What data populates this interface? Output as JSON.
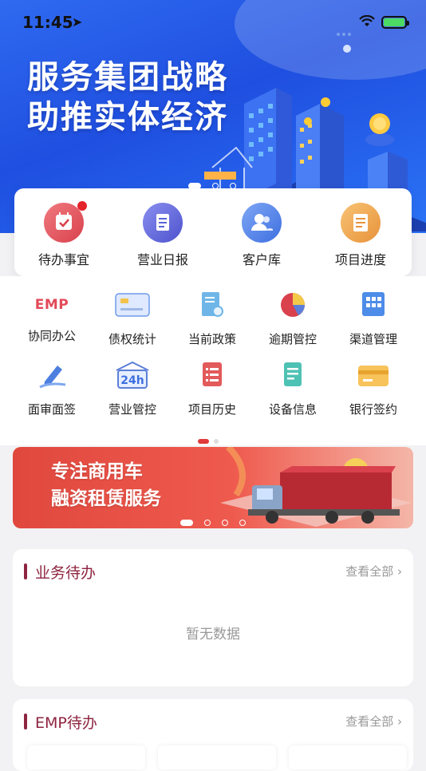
{
  "status_bar": {
    "time": "11:45",
    "location_icon": "location-arrow-icon"
  },
  "banner": {
    "line1": "服务集团战略",
    "line2": "助推实体经济"
  },
  "quick_actions": [
    {
      "label": "待办事宜",
      "icon": "calendar-check-icon",
      "color": "#e2545d",
      "badge": true
    },
    {
      "label": "营业日报",
      "icon": "document-icon",
      "color": "#5b63d8",
      "badge": false
    },
    {
      "label": "客户库",
      "icon": "users-icon",
      "color": "#4b7ee8",
      "badge": false
    },
    {
      "label": "项目进度",
      "icon": "list-icon",
      "color": "#efa24a",
      "badge": false
    }
  ],
  "grid_items": [
    {
      "label": "协同办公",
      "icon": "emp-logo-icon"
    },
    {
      "label": "债权统计",
      "icon": "card-icon"
    },
    {
      "label": "当前政策",
      "icon": "certificate-icon"
    },
    {
      "label": "逾期管控",
      "icon": "pie-chart-icon"
    },
    {
      "label": "渠道管理",
      "icon": "building-icon"
    },
    {
      "label": "面审面签",
      "icon": "pen-sign-icon"
    },
    {
      "label": "营业管控",
      "icon": "24h-icon"
    },
    {
      "label": "项目历史",
      "icon": "history-list-icon"
    },
    {
      "label": "设备信息",
      "icon": "device-doc-icon"
    },
    {
      "label": "银行签约",
      "icon": "bank-card-icon"
    }
  ],
  "emp_logo_text": "EMP",
  "h24_text": "24h",
  "promo": {
    "line1": "专注商用车",
    "line2": "融资租赁服务"
  },
  "business_todo": {
    "title": "业务待办",
    "view_all": "查看全部",
    "empty": "暂无数据"
  },
  "emp_todo": {
    "title": "EMP待办",
    "view_all": "查看全部"
  },
  "colors": {
    "accent": "#8e2440",
    "hero_blue": "#2458e8",
    "promo_red": "#e0483e"
  }
}
